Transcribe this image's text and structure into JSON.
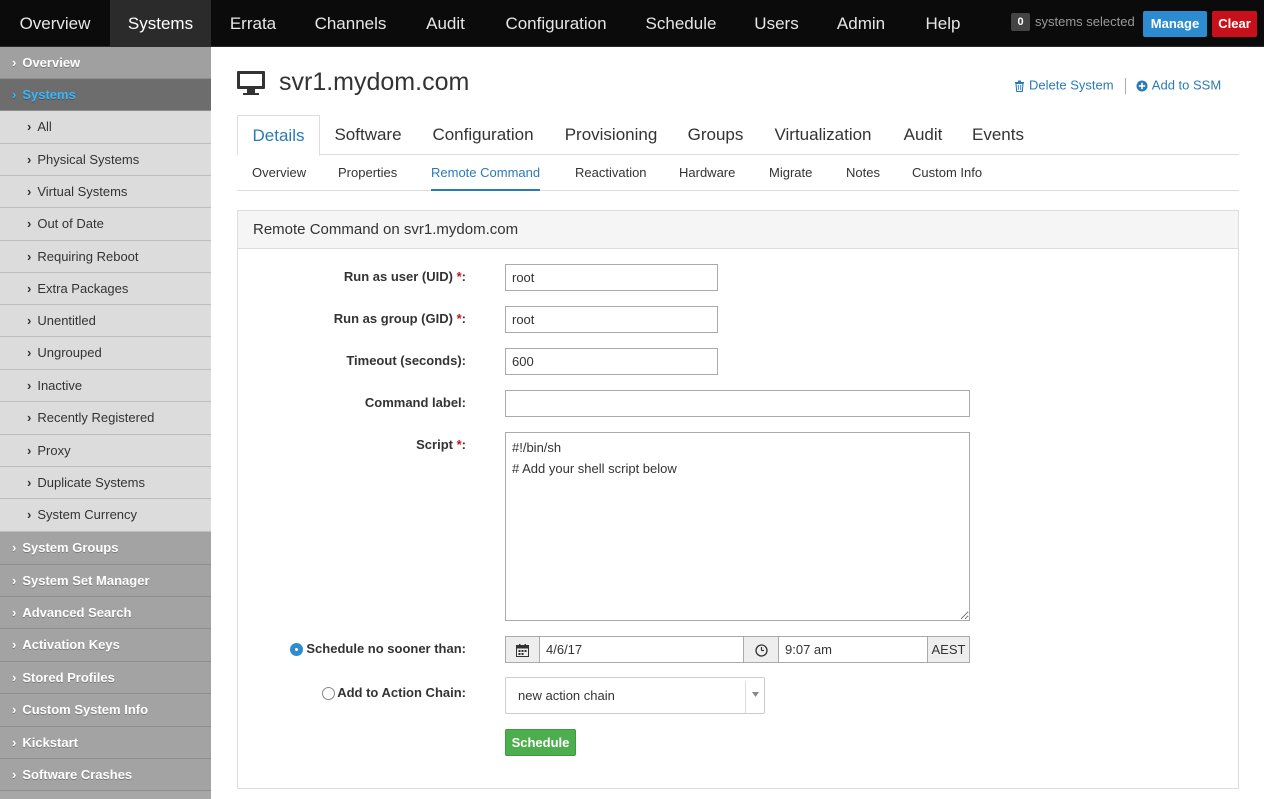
{
  "topnav": {
    "items": [
      "Overview",
      "Systems",
      "Errata",
      "Channels",
      "Audit",
      "Configuration",
      "Schedule",
      "Users",
      "Admin",
      "Help"
    ],
    "selected_count": "0",
    "selected_text": "systems selected",
    "manage_label": "Manage",
    "clear_label": "Clear"
  },
  "sidebar": {
    "top": [
      {
        "label": "Overview"
      },
      {
        "label": "Systems"
      }
    ],
    "sub": [
      "All",
      "Physical Systems",
      "Virtual Systems",
      "Out of Date",
      "Requiring Reboot",
      "Extra Packages",
      "Unentitled",
      "Ungrouped",
      "Inactive",
      "Recently Registered",
      "Proxy",
      "Duplicate Systems",
      "System Currency"
    ],
    "bottom": [
      "System Groups",
      "System Set Manager",
      "Advanced Search",
      "Activation Keys",
      "Stored Profiles",
      "Custom System Info",
      "Kickstart",
      "Software Crashes"
    ]
  },
  "page": {
    "title": "svr1.mydom.com",
    "delete_label": "Delete System",
    "ssm_label": "Add to SSM"
  },
  "tabs": [
    "Details",
    "Software",
    "Configuration",
    "Provisioning",
    "Groups",
    "Virtualization",
    "Audit",
    "Events"
  ],
  "subtabs": [
    "Overview",
    "Properties",
    "Remote Command",
    "Reactivation",
    "Hardware",
    "Migrate",
    "Notes",
    "Custom Info"
  ],
  "form": {
    "heading": "Remote Command on svr1.mydom.com",
    "uid_label": "Run as user (UID)",
    "uid_value": "root",
    "gid_label": "Run as group (GID)",
    "gid_value": "root",
    "timeout_label": "Timeout (seconds):",
    "timeout_value": "600",
    "cmdlabel_label": "Command label:",
    "cmdlabel_value": "",
    "script_label": "Script",
    "script_value": "#!/bin/sh\n# Add your shell script below",
    "schedule_label": "Schedule no sooner than:",
    "date_value": "4/6/17",
    "time_value": "9:07 am",
    "timezone": "AEST",
    "chain_label": "Add to Action Chain:",
    "chain_value": "new action chain",
    "schedule_button": "Schedule",
    "required_mark": "*",
    "colon": ":"
  }
}
